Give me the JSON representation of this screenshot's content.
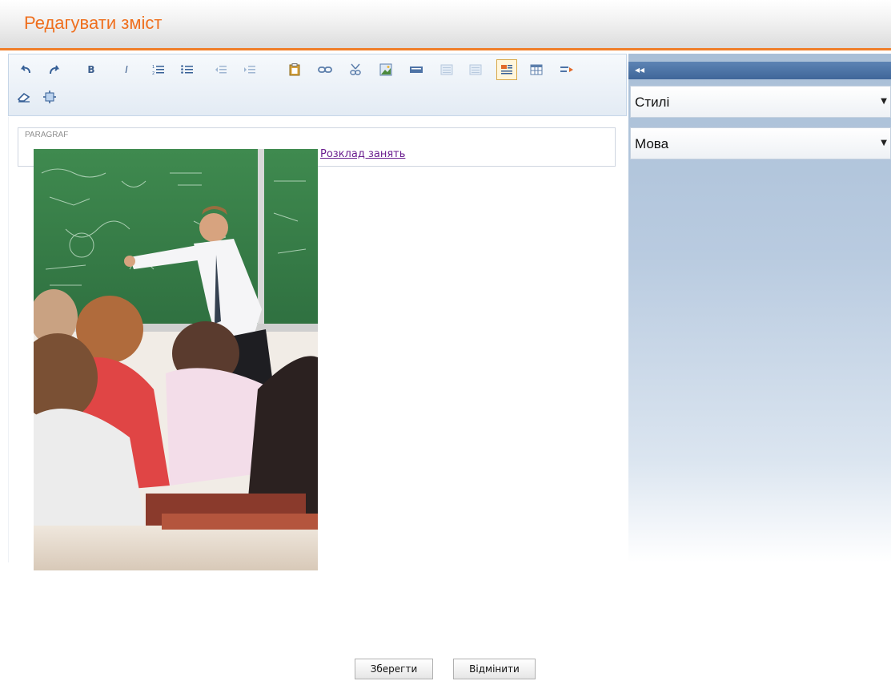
{
  "header": {
    "title": "Редагувати зміст"
  },
  "toolbar": {
    "row1": [
      {
        "name": "undo-icon",
        "glyph": "↶"
      },
      {
        "name": "redo-icon",
        "glyph": "↷"
      },
      {
        "name": "bold-icon",
        "glyph": "B"
      },
      {
        "name": "italic-icon",
        "glyph": "I"
      },
      {
        "name": "ordered-list-icon",
        "glyph": "≡"
      },
      {
        "name": "unordered-list-icon",
        "glyph": "☰"
      },
      {
        "name": "outdent-icon",
        "glyph": "⇤"
      },
      {
        "name": "indent-icon",
        "glyph": "⇥"
      },
      {
        "name": "paste-icon",
        "glyph": "📋"
      },
      {
        "name": "link-icon",
        "glyph": "🔗"
      },
      {
        "name": "unlink-icon",
        "glyph": "✂"
      },
      {
        "name": "image-icon",
        "glyph": "▣"
      },
      {
        "name": "media-icon",
        "glyph": "▬"
      },
      {
        "name": "align-left-icon",
        "glyph": "▤"
      },
      {
        "name": "align-right-icon",
        "glyph": "▥"
      },
      {
        "name": "format-block-icon",
        "glyph": "▦"
      },
      {
        "name": "table-icon",
        "glyph": "▦"
      },
      {
        "name": "wrap-text-icon",
        "glyph": "⇉"
      }
    ],
    "row2": [
      {
        "name": "eraser-icon",
        "glyph": "⌫"
      },
      {
        "name": "fullscreen-icon",
        "glyph": "⛶"
      }
    ]
  },
  "editor": {
    "paragraph_label": "PARAGRAF",
    "link_text": "Розклад занять"
  },
  "side_panel": {
    "collapse_glyph": "◂◂",
    "styles_label": "Стилі",
    "language_label": "Мова",
    "dropdown_arrow": "▼"
  },
  "actions": {
    "save_label": "Зберегти",
    "cancel_label": "Відмінити"
  }
}
